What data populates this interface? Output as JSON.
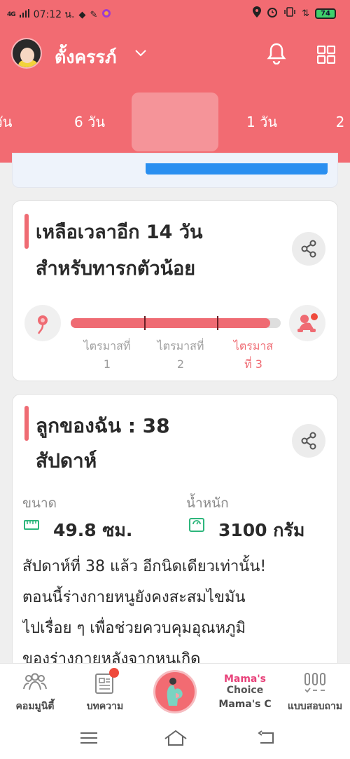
{
  "status_bar": {
    "signal": "4G",
    "time": "07:12 น.",
    "battery": "74"
  },
  "header": {
    "user_name": "ตั้งครรภ์",
    "weeks": [
      {
        "label": "วัน",
        "tick": "์"
      },
      {
        "label": "6 วัน",
        "tick": "้ั"
      },
      {
        "label": "",
        "tick": "้ั ั ์"
      },
      {
        "label": "1 วัน",
        "tick": "้ั ์"
      },
      {
        "label": "2",
        "tick": "้ั"
      }
    ]
  },
  "countdown_card": {
    "title_line1": "เหลือเวลาอีก 14 วัน",
    "title_line2": "สำหรับทารกตัวน้อย",
    "progress_fraction": 0.95,
    "trimesters": [
      {
        "label_line1": "ไตรมาสที่",
        "label_line2": "1",
        "active": false
      },
      {
        "label_line1": "ไตรมาสที่",
        "label_line2": "2",
        "active": false
      },
      {
        "label_line1": "ไตรมาส",
        "label_line2": "ที่ 3",
        "active": true
      }
    ]
  },
  "baby_card": {
    "title_line1": "ลูกของฉัน :  38",
    "title_line2": "สัปดาห์",
    "size_label": "ขนาด",
    "size_value": "49.8 ซม.",
    "weight_label": "น้ำหนัก",
    "weight_value": "3100 กรัม",
    "description_lines": [
      "สัปดาห์ที่ 38 แล้ว อีกนิดเดียวเท่านั้น!",
      "ตอนนี้ร่างกายหนูยังคงสะสมไขมัน",
      "ไปเรื่อย ๆ เพื่อช่วยควบคุมอุณหภูมิ",
      "ของร่างกายหลังจากหนูเกิด"
    ]
  },
  "bottom_nav": {
    "items": [
      {
        "label": "คอมมูนิตี้"
      },
      {
        "label": "บทความ"
      },
      {
        "label": ""
      },
      {
        "label": "Mama's C"
      },
      {
        "label": "แบบสอบถาม"
      }
    ],
    "logo_line1": "Mama's",
    "logo_line2": "Choice"
  },
  "colors": {
    "brand": "#f26b72",
    "accent_blue": "#2a8ff0",
    "icon_green": "#2db67c"
  }
}
